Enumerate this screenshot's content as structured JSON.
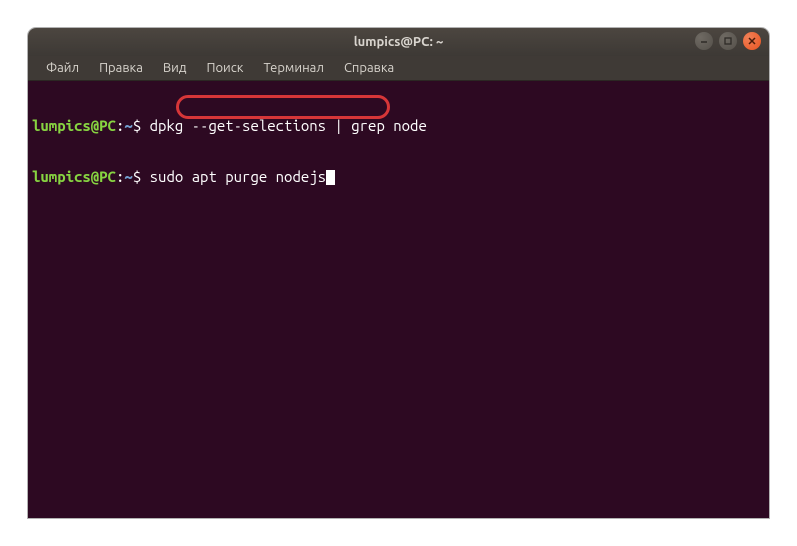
{
  "window": {
    "title": "lumpics@PC: ~"
  },
  "menubar": {
    "items": [
      {
        "label": "Файл"
      },
      {
        "label": "Правка"
      },
      {
        "label": "Вид"
      },
      {
        "label": "Поиск"
      },
      {
        "label": "Терминал"
      },
      {
        "label": "Справка"
      }
    ]
  },
  "terminal": {
    "lines": [
      {
        "user": "lumpics@PC",
        "sep": ":",
        "path": "~",
        "dollar": "$ ",
        "command": "dpkg --get-selections | grep node"
      },
      {
        "user": "lumpics@PC",
        "sep": ":",
        "path": "~",
        "dollar": "$ ",
        "command": "sudo apt purge nodejs"
      }
    ]
  },
  "controls": {
    "minimize": "–",
    "maximize": "□",
    "close": "✕"
  }
}
